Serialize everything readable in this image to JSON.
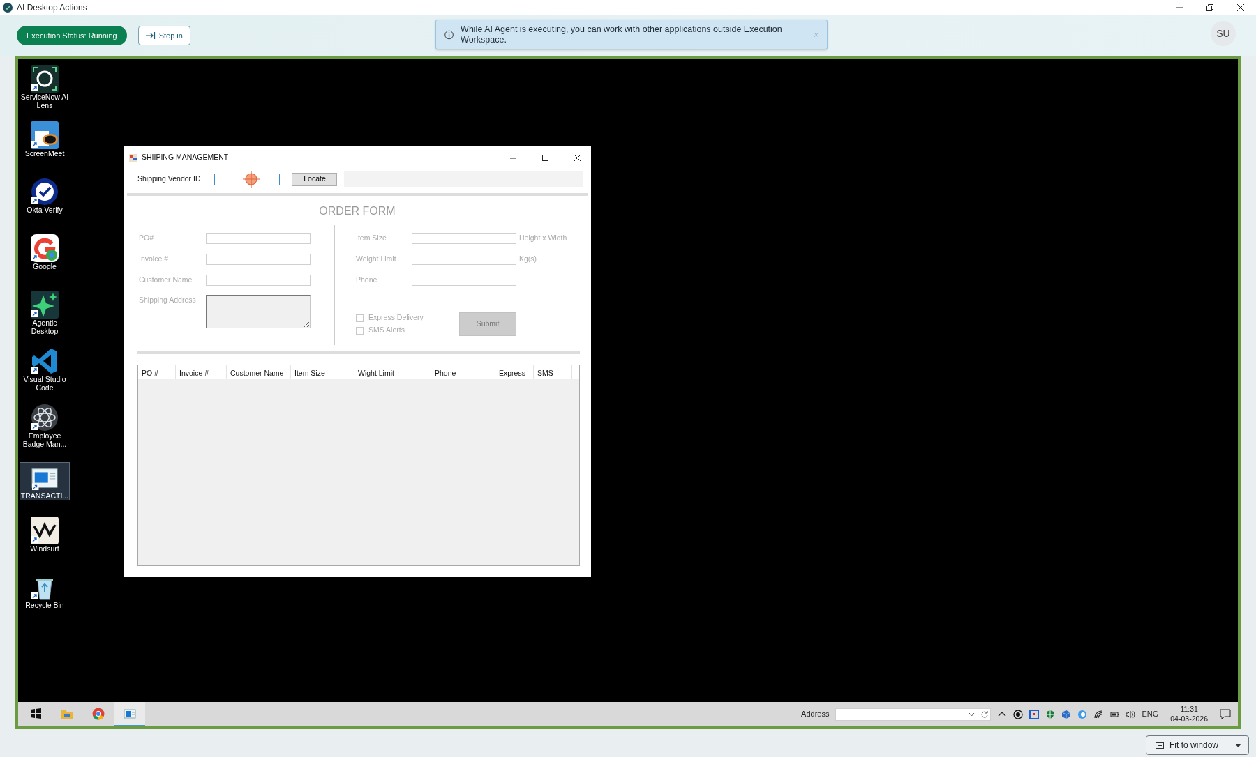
{
  "window": {
    "title": "AI Desktop Actions"
  },
  "toolbar": {
    "status": "Execution Status: Running",
    "running": true,
    "step_button": "Step in"
  },
  "toast": {
    "message": "While AI Agent is executing, you can work with other applications outside Execution Workspace."
  },
  "avatar": "SU",
  "desktop_icons": [
    {
      "label": "ServiceNow AI Lens",
      "kind": "lens",
      "selected": false
    },
    {
      "label": "ScreenMeet",
      "kind": "screenmeet",
      "selected": false
    },
    {
      "label": "Okta Verify",
      "kind": "okta",
      "selected": false
    },
    {
      "label": "Google",
      "kind": "google",
      "selected": false
    },
    {
      "label": "Agentic Desktop",
      "kind": "agentic",
      "selected": false
    },
    {
      "label": "Visual Studio Code",
      "kind": "vscode",
      "selected": false
    },
    {
      "label": "Employee Badge Man...",
      "kind": "badge",
      "selected": false
    },
    {
      "label": "TRANSACTI...",
      "kind": "transaction",
      "selected": true
    },
    {
      "label": "Windsurf",
      "kind": "windsurf",
      "selected": false
    },
    {
      "label": "Recycle Bin",
      "kind": "recycle",
      "selected": false
    }
  ],
  "app_window": {
    "title": "SHIIPING MANAGEMENT",
    "vendor_label": "Shipping Vendor ID",
    "locate_button": "Locate",
    "order_form": {
      "title": "ORDER FORM",
      "disabled": true,
      "left_fields": [
        {
          "label": "PO#",
          "kind": "input"
        },
        {
          "label": "Invoice #",
          "kind": "input"
        },
        {
          "label": "Customer Name",
          "kind": "input"
        },
        {
          "label": "Shipping Address",
          "kind": "textarea"
        }
      ],
      "right_fields": [
        {
          "label": "Item Size",
          "unit": "Height x Width"
        },
        {
          "label": "Weight Limit",
          "unit": "Kg(s)"
        },
        {
          "label": "Phone"
        }
      ],
      "checkboxes": [
        {
          "label": "Express Delivery",
          "checked": false
        },
        {
          "label": "SMS Alerts",
          "checked": false
        }
      ],
      "submit_button": "Submit"
    },
    "table": {
      "columns": [
        "PO #",
        "Invoice #",
        "Customer Name",
        "Item Size",
        "Wight Limit",
        "Phone",
        "Express",
        "SMS"
      ]
    }
  },
  "taskbar": {
    "apps": [
      {
        "kind": "start",
        "selected": false
      },
      {
        "kind": "explorer",
        "selected": false
      },
      {
        "kind": "chrome",
        "selected": false
      },
      {
        "kind": "transaction",
        "selected": true
      }
    ],
    "address_label": "Address",
    "language": "ENG",
    "time": "11:31",
    "date": "04-03-2026"
  },
  "footer": {
    "fit_button": "Fit to window"
  }
}
